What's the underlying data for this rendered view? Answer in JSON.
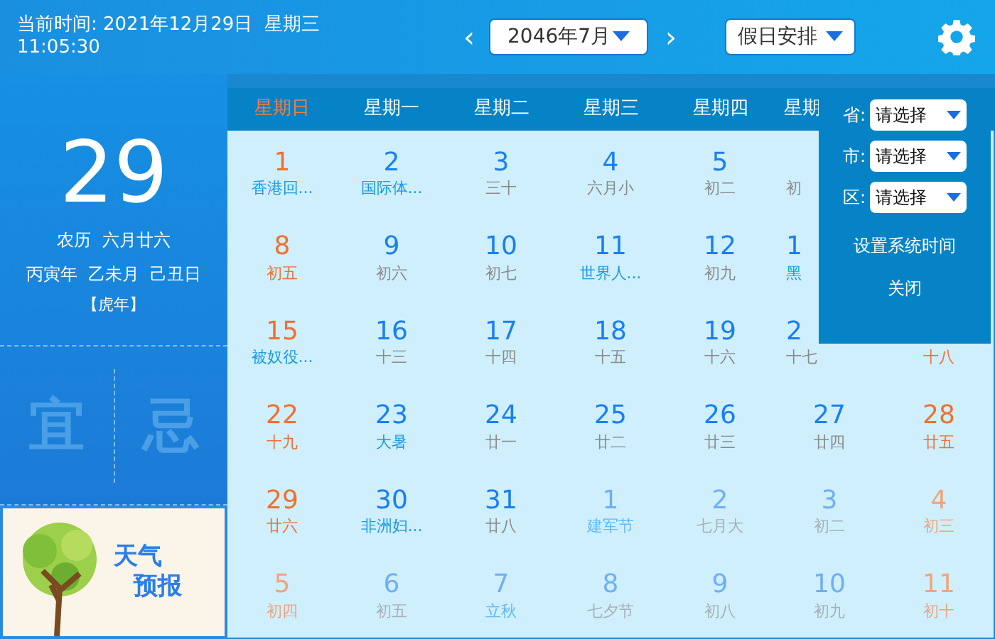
{
  "top_bar": {
    "current_time_label": "当前时间: 2021年12月29日  星期三",
    "current_time_clock": "11:05:30",
    "prev": "‹",
    "month_select": "2046年7月",
    "next": "›",
    "holiday_select": "假日安排"
  },
  "today": {
    "day": "29",
    "lunar": "农历  六月廿六",
    "ganzhi": "丙寅年  乙未月  己丑日",
    "zodiac": "【虎年】",
    "yi": "宜",
    "ji": "忌"
  },
  "weather": {
    "title_1": "天气",
    "title_2": "预报"
  },
  "weekdays": [
    {
      "label": "星期日",
      "weekend": true
    },
    {
      "label": "星期一",
      "weekend": false
    },
    {
      "label": "星期二",
      "weekend": false
    },
    {
      "label": "星期三",
      "weekend": false
    },
    {
      "label": "星期四",
      "weekend": false
    },
    {
      "label": "星期",
      "weekend": false
    }
  ],
  "rows": [
    [
      {
        "day": "1",
        "lunar": "香港回...",
        "festival": true,
        "weekend": true,
        "other_month": false
      },
      {
        "day": "2",
        "lunar": "国际体...",
        "festival": true,
        "weekend": false,
        "other_month": false
      },
      {
        "day": "3",
        "lunar": "三十",
        "festival": false,
        "weekend": false,
        "other_month": false
      },
      {
        "day": "4",
        "lunar": "六月小",
        "festival": false,
        "weekend": false,
        "other_month": false
      },
      {
        "day": "5",
        "lunar": "初二",
        "festival": false,
        "weekend": false,
        "other_month": false
      },
      {
        "lunar": "初",
        "festival": false,
        "weekend": false,
        "other_month": false,
        "partial": true
      },
      null
    ],
    [
      {
        "day": "8",
        "lunar": "初五",
        "festival": false,
        "weekend": true,
        "other_month": false
      },
      {
        "day": "9",
        "lunar": "初六",
        "festival": false,
        "weekend": false,
        "other_month": false
      },
      {
        "day": "10",
        "lunar": "初七",
        "festival": false,
        "weekend": false,
        "other_month": false
      },
      {
        "day": "11",
        "lunar": "世界人...",
        "festival": true,
        "weekend": false,
        "other_month": false
      },
      {
        "day": "12",
        "lunar": "初九",
        "festival": false,
        "weekend": false,
        "other_month": false
      },
      {
        "day": "1",
        "lunar": "黑",
        "festival": true,
        "weekend": false,
        "other_month": false,
        "partial": true
      },
      null
    ],
    [
      {
        "day": "15",
        "lunar": "被奴役...",
        "festival": true,
        "weekend": true,
        "other_month": false
      },
      {
        "day": "16",
        "lunar": "十三",
        "festival": false,
        "weekend": false,
        "other_month": false
      },
      {
        "day": "17",
        "lunar": "十四",
        "festival": false,
        "weekend": false,
        "other_month": false
      },
      {
        "day": "18",
        "lunar": "十五",
        "festival": false,
        "weekend": false,
        "other_month": false
      },
      {
        "day": "19",
        "lunar": "十六",
        "festival": false,
        "weekend": false,
        "other_month": false
      },
      {
        "day": "2",
        "lunar": "十七",
        "festival": false,
        "weekend": false,
        "other_month": false,
        "partial": true
      },
      {
        "lunar": "十八",
        "festival": false,
        "weekend": true,
        "other_month": false
      }
    ],
    [
      {
        "day": "22",
        "lunar": "十九",
        "festival": false,
        "weekend": true,
        "other_month": false
      },
      {
        "day": "23",
        "lunar": "大暑",
        "festival": true,
        "weekend": false,
        "other_month": false
      },
      {
        "day": "24",
        "lunar": "廿一",
        "festival": false,
        "weekend": false,
        "other_month": false
      },
      {
        "day": "25",
        "lunar": "廿二",
        "festival": false,
        "weekend": false,
        "other_month": false
      },
      {
        "day": "26",
        "lunar": "廿三",
        "festival": false,
        "weekend": false,
        "other_month": false
      },
      {
        "day": "27",
        "lunar": "廿四",
        "festival": false,
        "weekend": false,
        "other_month": false
      },
      {
        "day": "28",
        "lunar": "廿五",
        "festival": false,
        "weekend": true,
        "other_month": false
      }
    ],
    [
      {
        "day": "29",
        "lunar": "廿六",
        "festival": false,
        "weekend": true,
        "other_month": false
      },
      {
        "day": "30",
        "lunar": "非洲妇...",
        "festival": true,
        "weekend": false,
        "other_month": false
      },
      {
        "day": "31",
        "lunar": "廿八",
        "festival": false,
        "weekend": false,
        "other_month": false
      },
      {
        "day": "1",
        "lunar": "建军节",
        "festival": true,
        "weekend": false,
        "other_month": true
      },
      {
        "day": "2",
        "lunar": "七月大",
        "festival": false,
        "weekend": false,
        "other_month": true
      },
      {
        "day": "3",
        "lunar": "初二",
        "festival": false,
        "weekend": false,
        "other_month": true
      },
      {
        "day": "4",
        "lunar": "初三",
        "festival": false,
        "weekend": true,
        "other_month": true
      }
    ],
    [
      {
        "day": "5",
        "lunar": "初四",
        "festival": false,
        "weekend": true,
        "other_month": true
      },
      {
        "day": "6",
        "lunar": "初五",
        "festival": false,
        "weekend": false,
        "other_month": true
      },
      {
        "day": "7",
        "lunar": "立秋",
        "festival": true,
        "weekend": false,
        "other_month": true
      },
      {
        "day": "8",
        "lunar": "七夕节",
        "festival": false,
        "weekend": false,
        "other_month": true
      },
      {
        "day": "9",
        "lunar": "初八",
        "festival": false,
        "weekend": false,
        "other_month": true
      },
      {
        "day": "10",
        "lunar": "初九",
        "festival": false,
        "weekend": false,
        "other_month": true
      },
      {
        "day": "11",
        "lunar": "初十",
        "festival": false,
        "weekend": true,
        "other_month": true
      }
    ]
  ],
  "location_panel": {
    "fields": [
      {
        "label": "省:",
        "value": "请选择"
      },
      {
        "label": "市:",
        "value": "请选择"
      },
      {
        "label": "区:",
        "value": "请选择"
      }
    ],
    "set_time": "设置系统时间",
    "close": "关闭"
  }
}
